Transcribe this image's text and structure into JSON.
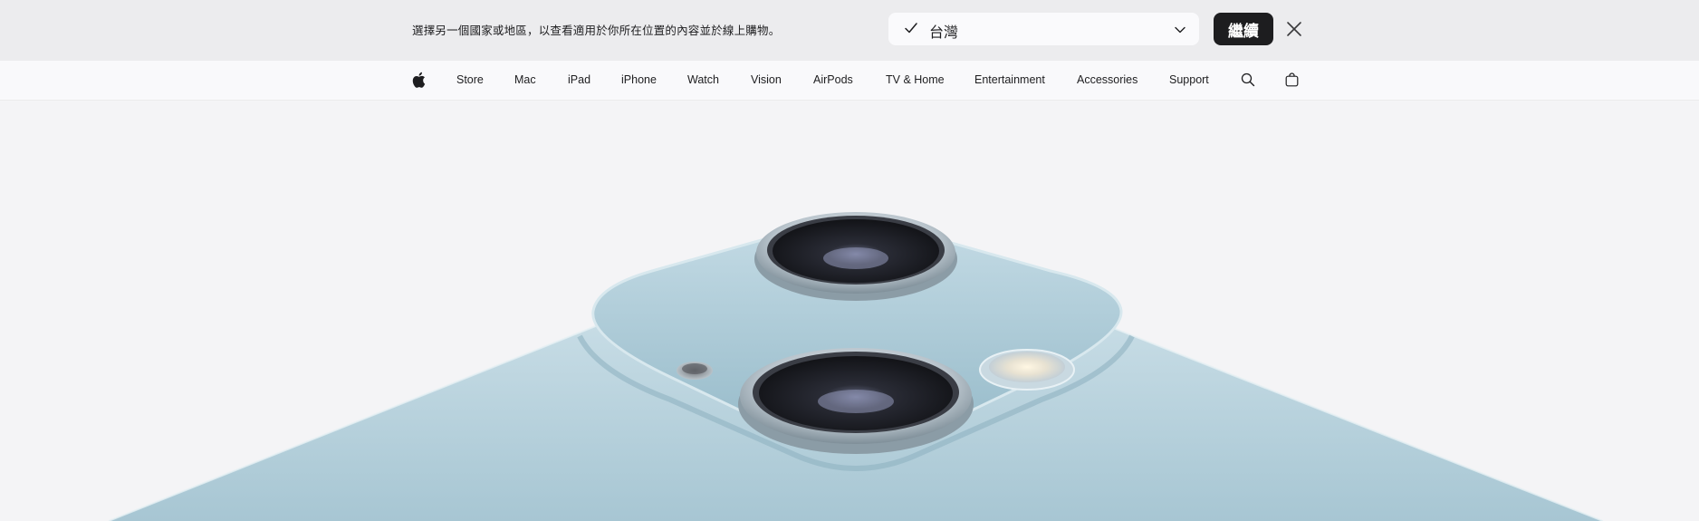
{
  "locale_banner": {
    "message": "選擇另一個國家或地區，以查看適用於你所在位置的內容並於線上購物。",
    "selected_region": "台灣",
    "continue_label": "繼續"
  },
  "nav": {
    "items": [
      {
        "label": "Store"
      },
      {
        "label": "Mac"
      },
      {
        "label": "iPad"
      },
      {
        "label": "iPhone"
      },
      {
        "label": "Watch"
      },
      {
        "label": "Vision"
      },
      {
        "label": "AirPods"
      },
      {
        "label": "TV & Home"
      },
      {
        "label": "Entertainment"
      },
      {
        "label": "Accessories"
      },
      {
        "label": "Support"
      }
    ],
    "icons": {
      "logo": "apple-logo-icon",
      "search": "search-icon",
      "bag": "bag-icon"
    }
  },
  "hero": {
    "image": "iphone-camera-bump-image",
    "device_color": "#b7d4df"
  }
}
